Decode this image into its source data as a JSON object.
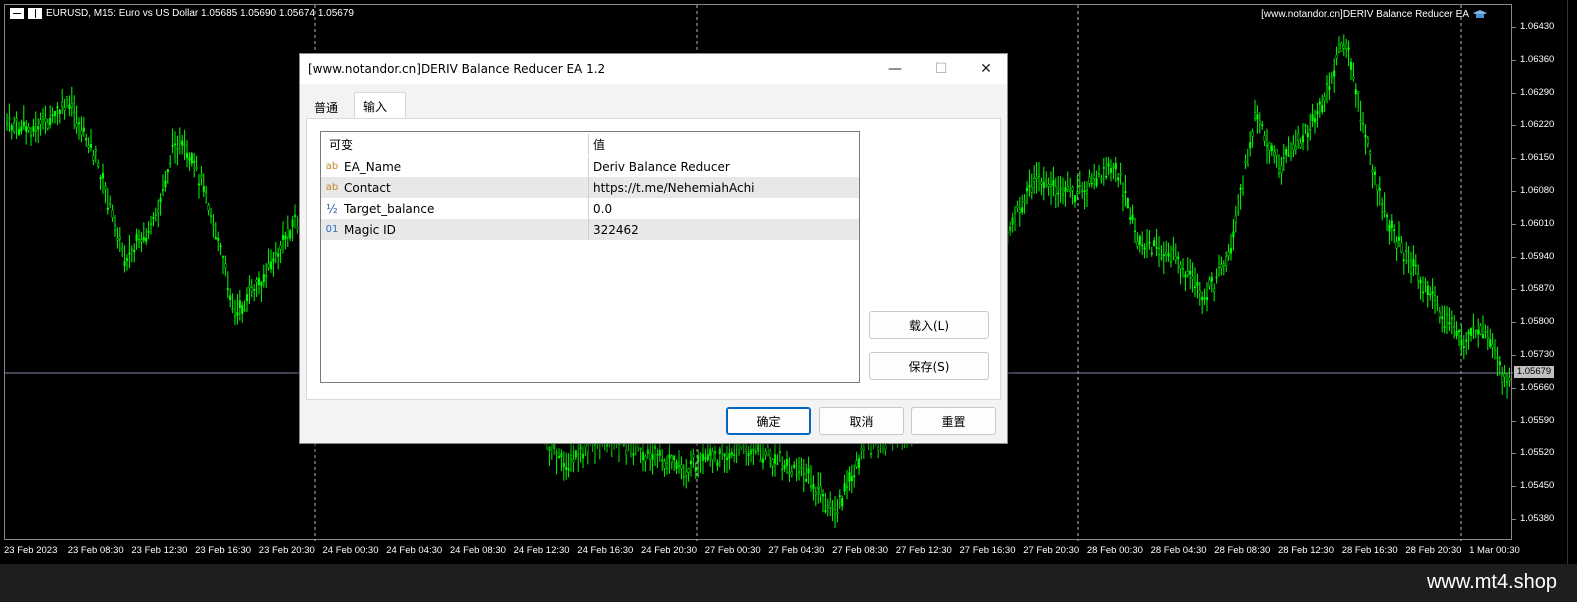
{
  "chart": {
    "symbol_header": "EURUSD, M15:  Euro vs US Dollar  1.05685 1.05690 1.05674 1.05679",
    "ea_label": "[www.notandor.cn]DERIV Balance Reducer EA",
    "current_price": "1.05679",
    "price_ticks": [
      "1.06430",
      "1.06360",
      "1.06290",
      "1.06220",
      "1.06150",
      "1.06080",
      "1.06010",
      "1.05940",
      "1.05870",
      "1.05800",
      "1.05730",
      "1.05660",
      "1.05590",
      "1.05520",
      "1.05450",
      "1.05380"
    ],
    "time_ticks": [
      "23 Feb 2023",
      "23 Feb 08:30",
      "23 Feb 12:30",
      "23 Feb 16:30",
      "23 Feb 20:30",
      "24 Feb 00:30",
      "24 Feb 04:30",
      "24 Feb 08:30",
      "24 Feb 12:30",
      "24 Feb 16:30",
      "24 Feb 20:30",
      "27 Feb 00:30",
      "27 Feb 04:30",
      "27 Feb 08:30",
      "27 Feb 12:30",
      "27 Feb 16:30",
      "27 Feb 20:30",
      "28 Feb 00:30",
      "28 Feb 04:30",
      "28 Feb 08:30",
      "28 Feb 12:30",
      "28 Feb 16:30",
      "28 Feb 20:30",
      "1 Mar 00:30"
    ],
    "candle_color": "#00ff00",
    "background": "#000000"
  },
  "watermark": "www.mt4.shop",
  "dialog": {
    "title": "[www.notandor.cn]DERIV Balance Reducer EA 1.2",
    "minimize_glyph": "—",
    "maximize_glyph": "☐",
    "close_glyph": "✕",
    "tabs": [
      "普通",
      "输入"
    ],
    "active_tab": "输入",
    "table": {
      "headers": [
        "可变",
        "值"
      ],
      "rows": [
        {
          "type": "ab",
          "name": "EA_Name",
          "value": "Deriv Balance Reducer"
        },
        {
          "type": "ab",
          "name": "Contact",
          "value": "https://t.me/NehemiahAchi"
        },
        {
          "type": "½",
          "name": "Target_balance",
          "value": "0.0"
        },
        {
          "type": "01",
          "name": "Magic ID",
          "value": "322462"
        }
      ]
    },
    "buttons": {
      "load": "载入(L)",
      "save": "保存(S)",
      "ok": "确定",
      "cancel": "取消",
      "reset": "重置"
    }
  }
}
